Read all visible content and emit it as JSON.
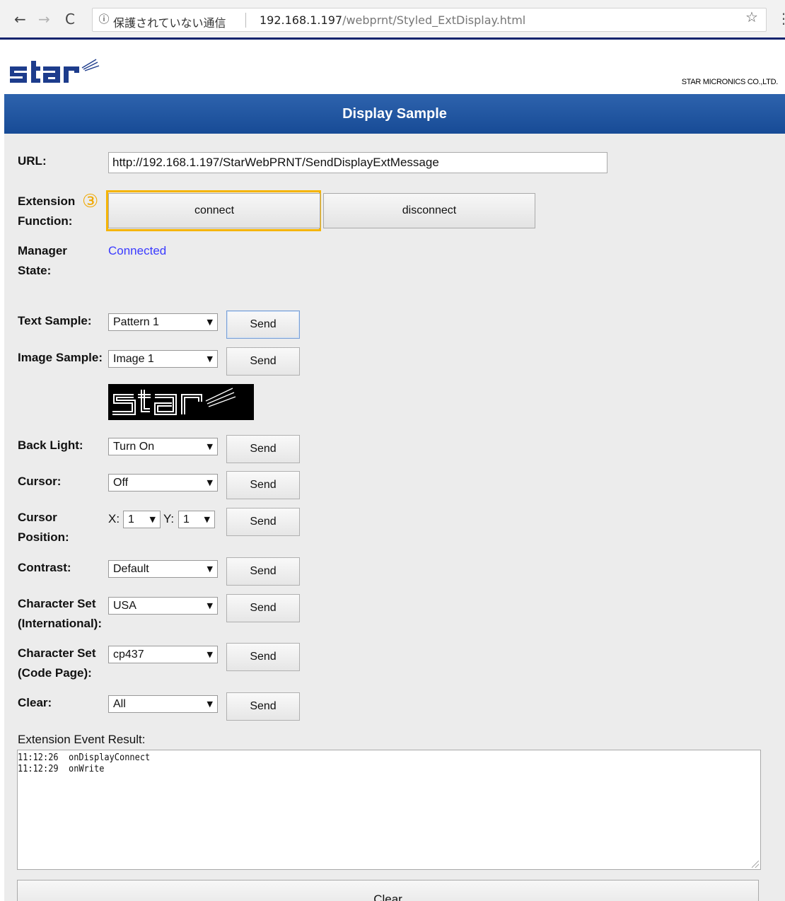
{
  "browser": {
    "security_text": "保護されていない通信",
    "url_host": "192.168.1.197",
    "url_path": "/webprnt/Styled_ExtDisplay.html",
    "icons": [
      "back-arrow-icon",
      "forward-arrow-icon",
      "reload-icon",
      "info-icon",
      "star-icon",
      "menu-icon"
    ]
  },
  "header": {
    "logo_text": "star",
    "company": "STAR MICRONICS CO.,LTD.",
    "title": "Display Sample",
    "brand_color": "#1f55a0"
  },
  "url": {
    "label": "URL:",
    "value": "http://192.168.1.197/StarWebPRNT/SendDisplayExtMessage"
  },
  "extension": {
    "label_line1": "Extension",
    "label_line2": "Function:",
    "annotation": "③",
    "connect_label": "connect",
    "disconnect_label": "disconnect"
  },
  "manager": {
    "label_line1": "Manager",
    "label_line2": "State:",
    "status": "Connected"
  },
  "controls": {
    "send_label": "Send",
    "text_sample": {
      "label": "Text Sample:",
      "value": "Pattern 1"
    },
    "image_sample": {
      "label": "Image Sample:",
      "value": "Image 1",
      "preview_text": "star"
    },
    "back_light": {
      "label": "Back Light:",
      "value": "Turn On"
    },
    "cursor": {
      "label": "Cursor:",
      "value": "Off"
    },
    "cursor_position": {
      "label_line1": "Cursor",
      "label_line2": "Position:",
      "x_label": "X:",
      "x_value": "1",
      "y_label": "Y:",
      "y_value": "1"
    },
    "contrast": {
      "label": "Contrast:",
      "value": "Default"
    },
    "charset_intl": {
      "label_line1": "Character Set",
      "label_line2": "(International):",
      "value": "USA"
    },
    "charset_code": {
      "label_line1": "Character Set",
      "label_line2": "(Code Page):",
      "value": "cp437"
    },
    "clear": {
      "label": "Clear:",
      "value": "All"
    }
  },
  "events": {
    "label": "Extension Event Result:",
    "lines": [
      "11:12:26  onDisplayConnect",
      "11:12:29  onWrite"
    ],
    "clear_label": "Clear"
  },
  "arrow_glyph": "▼"
}
